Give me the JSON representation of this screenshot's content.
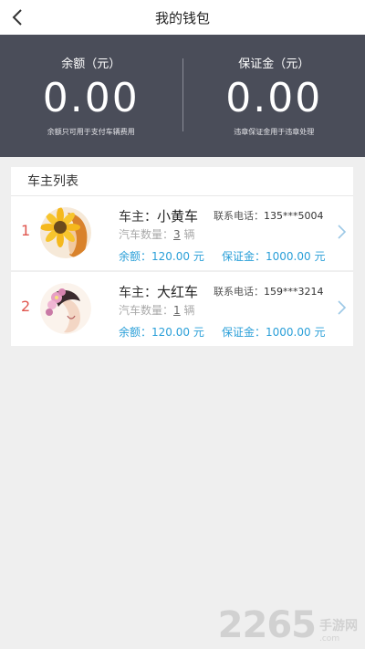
{
  "header": {
    "title": "我的钱包",
    "back_icon": "chevron-left-icon"
  },
  "wallet": {
    "balance_label": "余额（元）",
    "balance_amount": "0.00",
    "balance_note": "余额只可用于支付车辆费用",
    "deposit_label": "保证金（元）",
    "deposit_amount": "0.00",
    "deposit_note": "违章保证金用于违章处理"
  },
  "owner_list": {
    "title": "车主列表",
    "owner_prefix": "车主：",
    "phone_prefix": "联系电话：",
    "car_count_prefix": "汽车数量：",
    "car_count_unit": "辆",
    "balance_prefix": "余额：",
    "deposit_prefix": "保证金：",
    "currency_unit": "元",
    "items": [
      {
        "index": "1",
        "name": "小黄车",
        "phone": "135***5004",
        "car_count": "3",
        "balance": "120.00",
        "deposit": "1000.00",
        "avatar": "sunflower-girl-avatar"
      },
      {
        "index": "2",
        "name": "大红车",
        "phone": "159***3214",
        "car_count": "1",
        "balance": "120.00",
        "deposit": "1000.00",
        "avatar": "flower-girl-avatar"
      }
    ]
  },
  "watermark": {
    "big": "2265",
    "cn": "手游网",
    "url": ".com"
  },
  "colors": {
    "panel_bg": "#4a4d59",
    "accent_blue": "#2a9fd8",
    "index_red": "#e0564e"
  }
}
